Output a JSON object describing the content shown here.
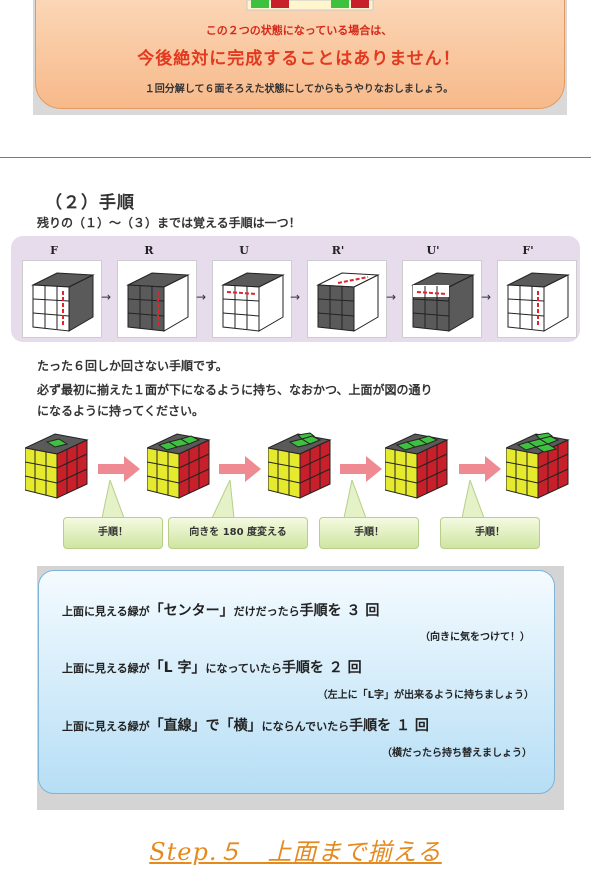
{
  "warning": {
    "line1": "この２つの状態になっている場合は、",
    "line2": "今後絶対に完成することはありません！",
    "line3": "１回分解して６面そろえた状態にしてからもうやりなおしましょう。"
  },
  "section": {
    "heading": "（２）手順",
    "subheading": "残りの（１）～（３）までは覚える手順は一つ！"
  },
  "moves": [
    {
      "label": "F",
      "icon": "cube-move-f-icon"
    },
    {
      "label": "R",
      "icon": "cube-move-r-icon"
    },
    {
      "label": "U",
      "icon": "cube-move-u-icon"
    },
    {
      "label": "R'",
      "icon": "cube-move-r-prime-icon"
    },
    {
      "label": "U'",
      "icon": "cube-move-u-prime-icon"
    },
    {
      "label": "F'",
      "icon": "cube-move-f-prime-icon"
    }
  ],
  "move_arrow": "→",
  "paragraph": {
    "line1": "たった６回しか回さない手順です。",
    "line2": "必ず最初に揃えた１面が下になるように持ち、なおかつ、上面が図の通り",
    "line3": "になるように持ってください。"
  },
  "callouts": [
    "手順！",
    "向きを 180 度変える",
    "手順！",
    "手順！"
  ],
  "instructions": [
    {
      "pre": "上面に見える緑が",
      "highlight": "「センター」",
      "mid": "だけだったら",
      "action": "手順を ３ 回",
      "note": "（向きに気をつけて！）"
    },
    {
      "pre": "上面に見える緑が",
      "highlight": "「L 字」",
      "mid": "になっていたら",
      "action": "手順を ２ 回",
      "note": "（左上に「L字」が出来るように持ちましょう）"
    },
    {
      "pre": "上面に見える緑が",
      "highlight": "「直線」で「横」",
      "mid": "にならんでいたら",
      "action": "手順を １ 回",
      "note": "（横だったら持ち替えましょう）"
    }
  ],
  "step_title": "Step.５　上面まで揃える",
  "colors": {
    "warning_text": "#d42a1a",
    "step_title": "#e58a1f",
    "cube_green": "#3ec13e",
    "cube_red": "#c8202a",
    "cube_yellow": "#e6ea2e",
    "cube_gray": "#5a5a5a",
    "arrow_pink": "#f08a92"
  }
}
